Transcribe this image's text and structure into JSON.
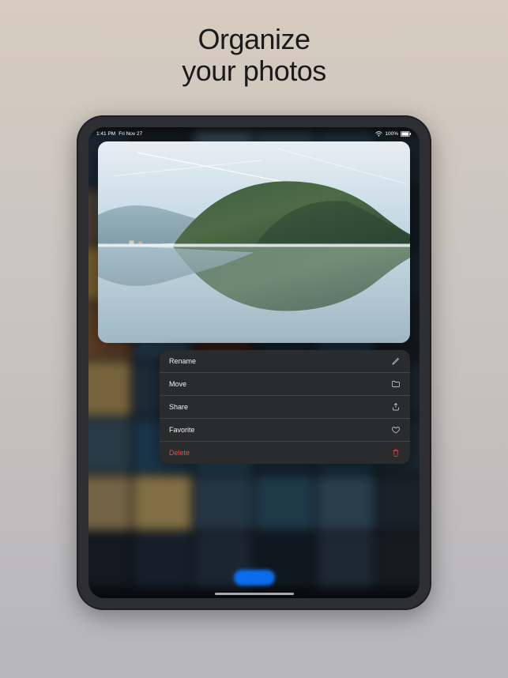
{
  "headline": {
    "line1": "Organize",
    "line2": "your photos"
  },
  "statusbar": {
    "time": "1:41 PM",
    "date": "Fri Nov 27",
    "battery_text": "100%"
  },
  "menu": {
    "items": [
      {
        "name": "rename",
        "label": "Rename",
        "icon": "pencil-icon",
        "destructive": false
      },
      {
        "name": "move",
        "label": "Move",
        "icon": "folder-icon",
        "destructive": false
      },
      {
        "name": "share",
        "label": "Share",
        "icon": "share-icon",
        "destructive": false
      },
      {
        "name": "favorite",
        "label": "Favorite",
        "icon": "heart-icon",
        "destructive": false
      },
      {
        "name": "delete",
        "label": "Delete",
        "icon": "trash-icon",
        "destructive": true
      }
    ]
  },
  "colors": {
    "accent": "#0b74ff",
    "destructive": "#ff453a",
    "menu_bg": "#2a2b2d"
  },
  "grid_cells": [
    "#2b3a4a",
    "#1f2a33",
    "#4f6a7a",
    "#3a5763",
    "#2f4a5c",
    "#24303c",
    "#6f6250",
    "#1e2026",
    "#8c5a33",
    "#355b7e",
    "#2d4b64",
    "#1b2630",
    "#bb9148",
    "#7a7660",
    "#2d4e3d",
    "#9fb8c9",
    "#5e6f7a",
    "#1f2e3c",
    "#8f603a",
    "#3a5b74",
    "#4d2e24",
    "#1d343f",
    "#2a4860",
    "#20272e",
    "#b79a5f",
    "#2c4256",
    "#4b6478",
    "#1f3140",
    "#5e7a8e",
    "#283642",
    "#3f5a6c",
    "#2a5270",
    "#356078",
    "#234055",
    "#244a62",
    "#2b3b48",
    "#b2996a",
    "#c7a969",
    "#3a5368",
    "#305870",
    "#3f5f74",
    "#27343f",
    "#1e2732",
    "#223040",
    "#2a3a4a",
    "#1a2530",
    "#2e3e4c",
    "#202a33"
  ]
}
